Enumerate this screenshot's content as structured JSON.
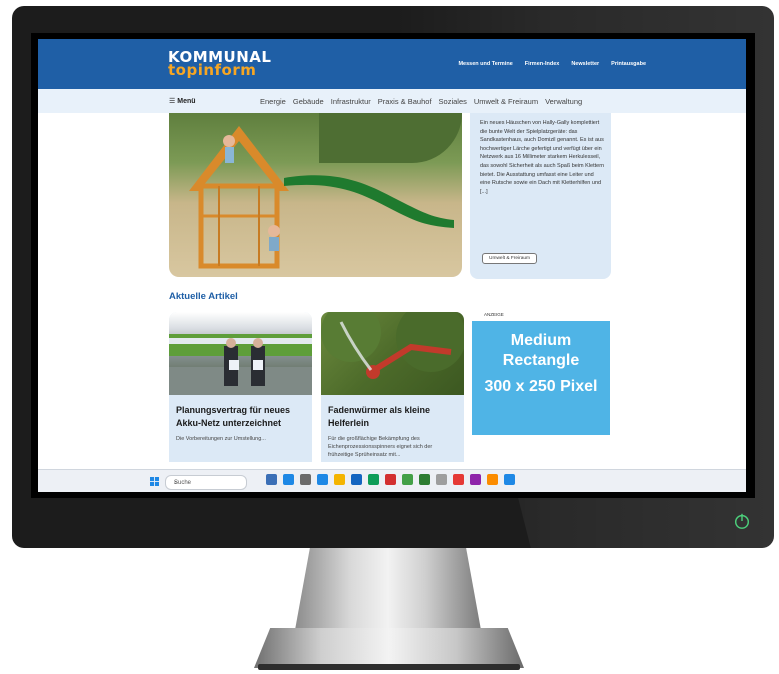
{
  "header": {
    "logo_line1": "KOMMUNAL",
    "logo_line2": "topinform",
    "nav": [
      "Messen und Termine",
      "Firmen-Index",
      "Newsletter",
      "Printausgabe"
    ]
  },
  "subnav": {
    "menu_label": "Menü",
    "categories": [
      "Energie",
      "Gebäude",
      "Infrastruktur",
      "Praxis & Bauhof",
      "Soziales",
      "Umwelt & Freiraum",
      "Verwaltung"
    ]
  },
  "teaser": {
    "text": "Ein neues Häuschen von Hally-Gally komplettiert die bunte Welt der Spielplatzgeräte: das Sandkastenhaus, auch Domizil genannt. Es ist aus hochwertiger Lärche gefertigt und verfügt über ein Netzwerk aus 16 Millimeter starkem Herkulesseil, das sowohl Sicherheit als auch Spaß beim Klettern bietet. Die Ausstattung umfasst eine Leiter und eine Rutsche sowie ein Dach mit Kletterhilfen und [...]",
    "tag": "Umwelt & Freiraum"
  },
  "section_title": "Aktuelle Artikel",
  "articles": [
    {
      "title": "Planungsvertrag für neues Akku-Netz unterzeichnet",
      "excerpt": "Die Vorbereitungen zur Umstellung..."
    },
    {
      "title": "Fadenwürmer als kleine Helferlein",
      "excerpt": "Für die großflächige Bekämpfung des Eichenprozessionsspinners eignet sich der frühzeitige Sprüheinsatz mit..."
    }
  ],
  "ad": {
    "label": "ANZEIGE",
    "line1": "Medium Rectangle",
    "line2": "300 x 250 Pixel"
  },
  "taskbar": {
    "search_placeholder": "Suche",
    "app_colors": [
      "#3b6fb6",
      "#1e88e5",
      "#6b6b6b",
      "#1e88e5",
      "#f4b400",
      "#1565c0",
      "#0f9d58",
      "#d32f2f",
      "#43a047",
      "#2e7d32",
      "#9e9e9e",
      "#e53935",
      "#8e24aa",
      "#fb8c00",
      "#1e88e5"
    ]
  }
}
